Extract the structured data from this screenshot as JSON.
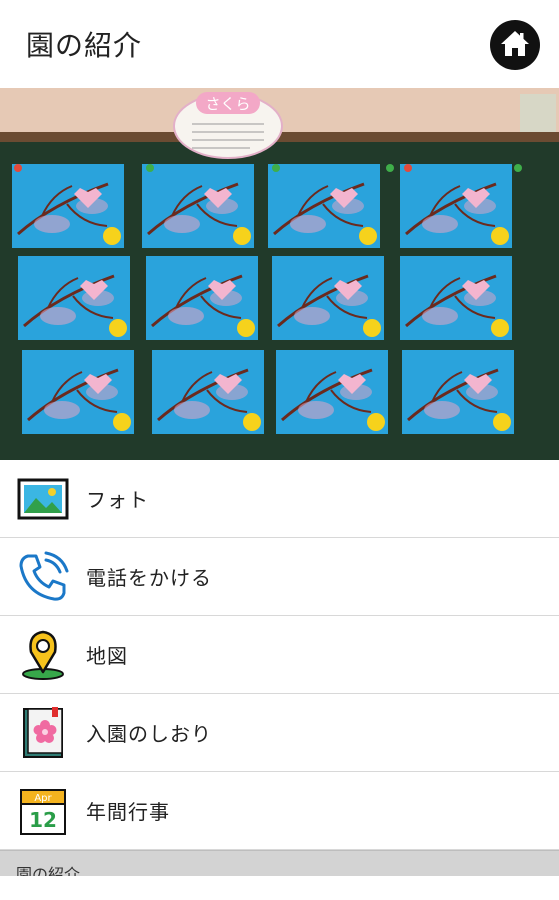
{
  "header": {
    "title": "園の紹介",
    "home_icon": "home-icon"
  },
  "hero": {
    "sign_title": "さくら",
    "image_desc_icon": "photo-of-cherry-blossom-artwork"
  },
  "menu": {
    "items": [
      {
        "label": "フォト",
        "icon": "photo-icon"
      },
      {
        "label": "電話をかける",
        "icon": "phone-icon"
      },
      {
        "label": "地図",
        "icon": "map-pin-icon"
      },
      {
        "label": "入園のしおり",
        "icon": "guidebook-icon"
      },
      {
        "label": "年間行事",
        "icon": "calendar-icon"
      }
    ]
  },
  "calendar_icon": {
    "month": "Apr",
    "day": "12"
  },
  "footer": {
    "label": "園の紹介"
  }
}
